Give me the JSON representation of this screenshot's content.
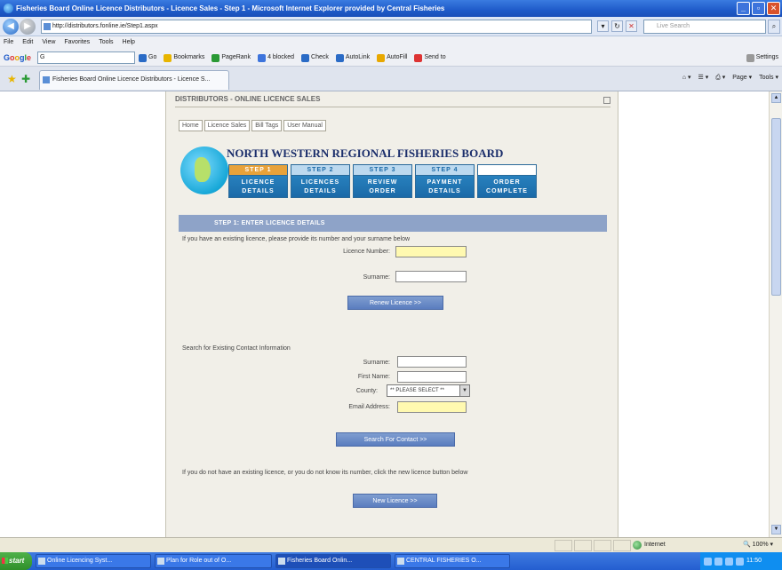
{
  "window": {
    "title": "Fisheries Board Online Licence Distributors - Licence Sales - Step 1 - Microsoft Internet Explorer provided by Central Fisheries"
  },
  "addressbar": {
    "url": "http://distributors.fonline.ie/Step1.aspx",
    "search_placeholder": "Live Search"
  },
  "menu": [
    "File",
    "Edit",
    "View",
    "Favorites",
    "Tools",
    "Help"
  ],
  "google_toolbar": {
    "logo": "Google",
    "search_value": "G",
    "items": [
      {
        "label": "Go",
        "icon": "go-icon",
        "color": "#2a6bc6"
      },
      {
        "label": "Bookmarks",
        "icon": "star-icon",
        "color": "#e8b500"
      },
      {
        "label": "PageRank",
        "icon": "pagerank-icon",
        "color": "#2a9a35"
      },
      {
        "label": "4 blocked",
        "icon": "popup-blocked-icon",
        "color": "#3d74dc"
      },
      {
        "label": "Check",
        "icon": "spellcheck-icon",
        "color": "#2a6bc6"
      },
      {
        "label": "AutoLink",
        "icon": "autolink-icon",
        "color": "#2a6bc6"
      },
      {
        "label": "AutoFill",
        "icon": "autofill-icon",
        "color": "#e8a800"
      },
      {
        "label": "Send to",
        "icon": "send-to-icon",
        "color": "#d33"
      }
    ],
    "settings_label": "Settings"
  },
  "tab": {
    "label": "Fisheries Board Online Licence Distributors - Licence S..."
  },
  "command_bar": [
    "Page",
    "Tools"
  ],
  "page": {
    "header_strip": "DISTRIBUTORS - ONLINE LICENCE SALES",
    "nav_links": [
      "Home",
      "Licence Sales",
      "Bill Tags",
      "User Manual"
    ],
    "board_title": "NORTH WESTERN REGIONAL FISHERIES BOARD",
    "steps": [
      {
        "num": "STEP 1",
        "line1": "LICENCE",
        "line2": "DETAILS",
        "active": true
      },
      {
        "num": "STEP 2",
        "line1": "LICENCES",
        "line2": "DETAILS",
        "active": false
      },
      {
        "num": "STEP 3",
        "line1": "REVIEW",
        "line2": "ORDER",
        "active": false
      },
      {
        "num": "STEP 4",
        "line1": "PAYMENT",
        "line2": "DETAILS",
        "active": false
      },
      {
        "num": "",
        "line1": "ORDER",
        "line2": "COMPLETE",
        "active": false
      }
    ],
    "section_title": "STEP 1: ENTER LICENCE DETAILS",
    "existing_text": "If you have an existing licence, please provide its number and your surname below",
    "licence_number_label": "Licence Number:",
    "surname_label": "Surname:",
    "renew_button": "Renew Licence >>",
    "search_heading": "Search for Existing Contact Information",
    "search_surname_label": "Surname:",
    "first_name_label": "First Name:",
    "county_label": "County:",
    "county_selected": "** PLEASE SELECT **",
    "email_label": "Email Address:",
    "search_button": "Search For Contact >>",
    "new_text": "If you do not have an existing licence, or you do not know its number, click the new licence button below",
    "new_button": "New Licence >>"
  },
  "statusbar": {
    "zone": "Internet",
    "zoom": "100%"
  },
  "taskbar": {
    "start": "start",
    "tasks": [
      "Online Licencing Syst...",
      "Plan for Role out of O...",
      "Fisheries Board Onlin...",
      "CENTRAL FISHERIES O..."
    ],
    "clock": "11:50"
  }
}
